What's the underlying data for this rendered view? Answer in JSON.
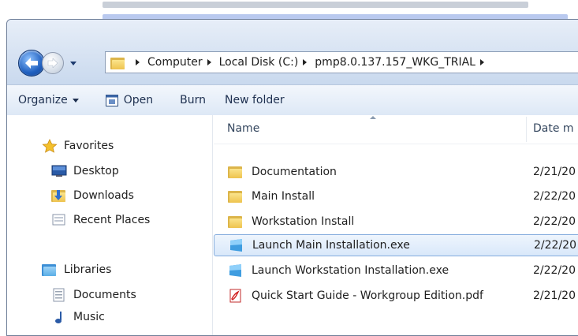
{
  "address": {
    "crumbs": [
      "Computer",
      "Local Disk (C:)",
      "pmp8.0.137.157_WKG_TRIAL"
    ]
  },
  "toolbar": {
    "organize_label": "Organize",
    "open_label": "Open",
    "burn_label": "Burn",
    "new_folder_label": "New folder"
  },
  "nav": {
    "favorites_label": "Favorites",
    "desktop_label": "Desktop",
    "downloads_label": "Downloads",
    "recent_label": "Recent Places",
    "libraries_label": "Libraries",
    "documents_label": "Documents",
    "music_label": "Music"
  },
  "columns": {
    "name": "Name",
    "date": "Date m"
  },
  "files": [
    {
      "name": "Documentation",
      "date": "2/21/20",
      "type": "folder"
    },
    {
      "name": "Main Install",
      "date": "2/22/20",
      "type": "folder"
    },
    {
      "name": "Workstation Install",
      "date": "2/22/20",
      "type": "folder"
    },
    {
      "name": "Launch Main Installation.exe",
      "date": "2/22/20",
      "type": "exe"
    },
    {
      "name": "Launch Workstation Installation.exe",
      "date": "2/22/20",
      "type": "exe"
    },
    {
      "name": "Quick Start Guide - Workgroup Edition.pdf",
      "date": "2/21/20",
      "type": "pdf"
    }
  ],
  "colors": {
    "selection": "#d9e8fa",
    "selection_border": "#84acdd",
    "frame": "#dbe6f4"
  }
}
